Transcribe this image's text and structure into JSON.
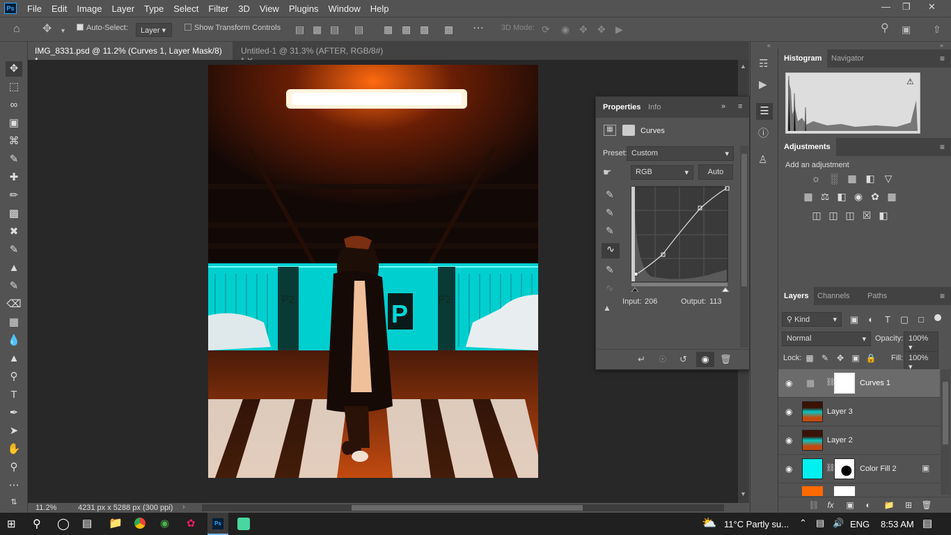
{
  "app": {
    "logo": "Ps"
  },
  "menu": [
    "File",
    "Edit",
    "Image",
    "Layer",
    "Type",
    "Select",
    "Filter",
    "3D",
    "View",
    "Plugins",
    "Window",
    "Help"
  ],
  "window_controls": [
    "minimize-icon",
    "restore-icon",
    "close-icon"
  ],
  "options": {
    "auto_select_label": "Auto-Select:",
    "auto_select_value": "Layer",
    "transform_controls_label": "Show Transform Controls",
    "mode_3d_label": "3D Mode:"
  },
  "tabs": [
    {
      "label": "IMG_8331.psd @ 11.2% (Curves 1, Layer Mask/8) *",
      "active": true
    },
    {
      "label": "Untitled-1 @ 31.3% (AFTER, RGB/8#) *",
      "active": false
    }
  ],
  "status": {
    "zoom": "11.2%",
    "doc_info": "4231 px x 5288 px (300 ppi)"
  },
  "properties": {
    "tabs": [
      "Properties",
      "Info"
    ],
    "title": "Curves",
    "preset_label": "Preset:",
    "preset_value": "Custom",
    "channel": "RGB",
    "auto_label": "Auto",
    "input_label": "Input:",
    "input_value": "206",
    "output_label": "Output:",
    "output_value": "113"
  },
  "histogram": {
    "tabs": [
      "Histogram",
      "Navigator"
    ]
  },
  "adjustments": {
    "title": "Adjustments",
    "add_label": "Add an adjustment"
  },
  "layers_panel": {
    "tabs": [
      "Layers",
      "Channels",
      "Paths"
    ],
    "filter_kind": "Kind",
    "blend_mode": "Normal",
    "opacity_label": "Opacity:",
    "opacity_value": "100%",
    "lock_label": "Lock:",
    "fill_label": "Fill:",
    "fill_value": "100%",
    "layers": [
      {
        "name": "Curves 1",
        "selected": true
      },
      {
        "name": "Layer 3",
        "selected": false
      },
      {
        "name": "Layer 2",
        "selected": false
      },
      {
        "name": "Color Fill 2",
        "selected": false
      }
    ]
  },
  "taskbar": {
    "weather": "11°C  Partly su...",
    "language": "ENG",
    "time": "8:53 AM"
  },
  "colors": {
    "ps_blue": "#31a8ff",
    "cyan_fill": "#00f0f0",
    "orange_fill": "#ff6a00"
  }
}
